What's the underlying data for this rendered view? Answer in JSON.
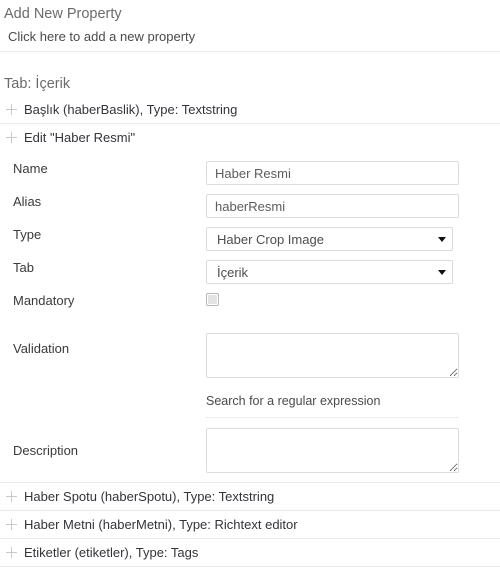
{
  "add_property": {
    "title": "Add New Property",
    "link_label": "Click here to add a new property"
  },
  "tab_section": {
    "title": "Tab: İçerik"
  },
  "properties_before": [
    {
      "label": "Başlık (haberBaslik), Type: Textstring",
      "icon": "plus-icon"
    }
  ],
  "edit_panel": {
    "header_label": "Edit \"Haber Resmi\"",
    "header_icon": "plus-icon",
    "fields": {
      "name": {
        "label": "Name",
        "value": "Haber Resmi",
        "placeholder": ""
      },
      "alias": {
        "label": "Alias",
        "value": "haberResmi",
        "placeholder": ""
      },
      "type": {
        "label": "Type",
        "value": "Haber Crop Image",
        "options": [
          "Haber Crop Image"
        ],
        "caret_icon": "chevron-down-icon"
      },
      "tab": {
        "label": "Tab",
        "value": "İçerik",
        "options": [
          "İçerik"
        ],
        "caret_icon": "chevron-down-icon"
      },
      "mandatory": {
        "label": "Mandatory",
        "checked": false
      },
      "validation": {
        "label": "Validation",
        "value": "",
        "helper": "Search for a regular expression"
      },
      "description": {
        "label": "Description",
        "value": ""
      }
    }
  },
  "properties_after": [
    {
      "label": "Haber Spotu (haberSpotu), Type: Textstring",
      "icon": "plus-icon"
    },
    {
      "label": "Haber Metni (haberMetni), Type: Richtext editor",
      "icon": "plus-icon"
    },
    {
      "label": "Etiketler (etiketler), Type: Tags",
      "icon": "plus-icon"
    }
  ],
  "colors": {
    "border": "#dcdcdc",
    "divider": "#e9e9e9",
    "heading_text": "#6b6b6b",
    "body_text": "#33343a",
    "plus_icon": "#c9c9c9"
  }
}
